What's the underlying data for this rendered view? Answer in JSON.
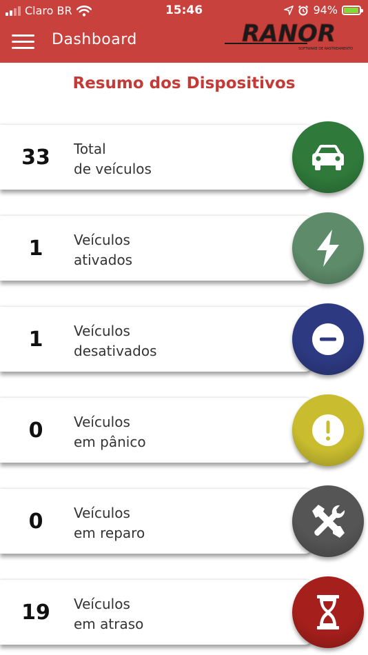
{
  "status_bar": {
    "carrier": "Claro BR",
    "time": "15:46",
    "battery_percent": "94%",
    "battery_level": 0.94
  },
  "app_bar": {
    "title": "Dashboard",
    "logo_text": "RANOR",
    "logo_tagline": "SOFTWARE DE RASTREAMENTO"
  },
  "section_title": "Resumo dos Dispositivos",
  "colors": {
    "brand_red": "#c8413d",
    "title_red": "#c43a36"
  },
  "cards": [
    {
      "count": "33",
      "line1": "Total",
      "line2": "de veículos",
      "icon": "car-icon",
      "color": "#2f7a3a"
    },
    {
      "count": "1",
      "line1": "Veículos",
      "line2": "ativados",
      "icon": "lightning-icon",
      "color": "#5e8c6a"
    },
    {
      "count": "1",
      "line1": "Veículos",
      "line2": "desativados",
      "icon": "minus-circle-icon",
      "color": "#2d3a82"
    },
    {
      "count": "0",
      "line1": "Veículos",
      "line2": "em pânico",
      "icon": "alert-icon",
      "color": "#c9bd2f"
    },
    {
      "count": "0",
      "line1": "Veículos",
      "line2": "em reparo",
      "icon": "tools-icon",
      "color": "#555555"
    },
    {
      "count": "19",
      "line1": "Veículos",
      "line2": "em atraso",
      "icon": "hourglass-icon",
      "color": "#a51f1c"
    }
  ]
}
